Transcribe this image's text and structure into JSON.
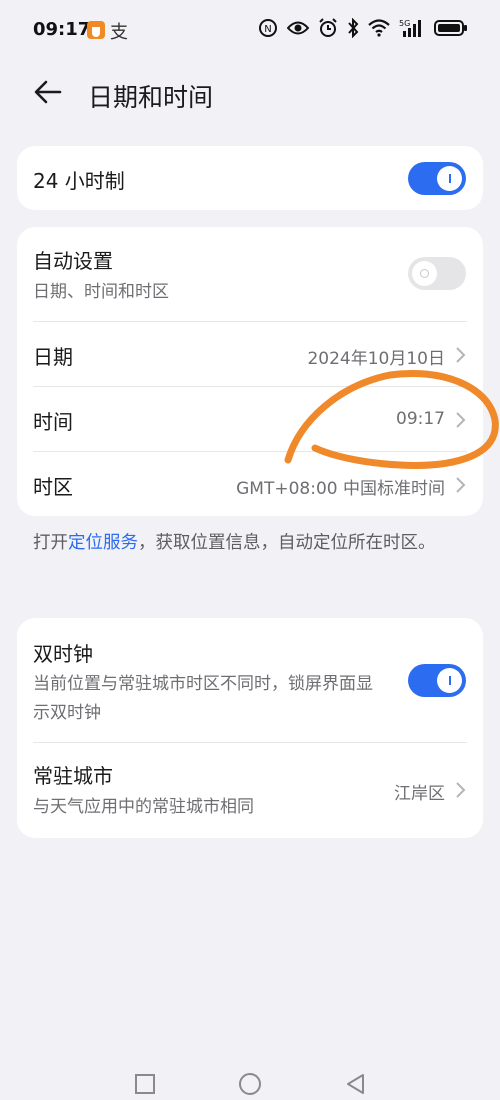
{
  "status_bar": {
    "time": "09:17",
    "app_icon_2": "支",
    "icons": [
      "nfc-icon",
      "eye-icon",
      "alarm-icon",
      "bluetooth-icon",
      "wifi-icon",
      "signal-5g-icon",
      "battery-icon"
    ],
    "network_label": "5G"
  },
  "header": {
    "title": "日期和时间",
    "back_icon": "arrow-left-icon"
  },
  "settings": {
    "hour24": {
      "label": "24 小时制",
      "enabled": true
    },
    "auto": {
      "label": "自动设置",
      "sub": "日期、时间和时区",
      "enabled": false
    },
    "date": {
      "label": "日期",
      "value": "2024年10月10日"
    },
    "time": {
      "label": "时间",
      "value": "09:17"
    },
    "timezone": {
      "label": "时区",
      "value": "GMT+08:00 中国标准时间"
    }
  },
  "note": {
    "prefix": "打开",
    "link": "定位服务",
    "suffix": "，获取位置信息，自动定位所在时区。"
  },
  "dual_clock": {
    "label": "双时钟",
    "sub": "当前位置与常驻城市时区不同时，锁屏界面显示双时钟",
    "enabled": true
  },
  "home_city": {
    "label": "常驻城市",
    "sub": "与天气应用中的常驻城市相同",
    "value": "江岸区"
  },
  "colors": {
    "accent": "#2b6cf0",
    "background": "#f1f1f6",
    "annotation": "#f0892a"
  },
  "nav_icons": [
    "recent-apps-square-icon",
    "home-circle-icon",
    "back-triangle-icon"
  ]
}
